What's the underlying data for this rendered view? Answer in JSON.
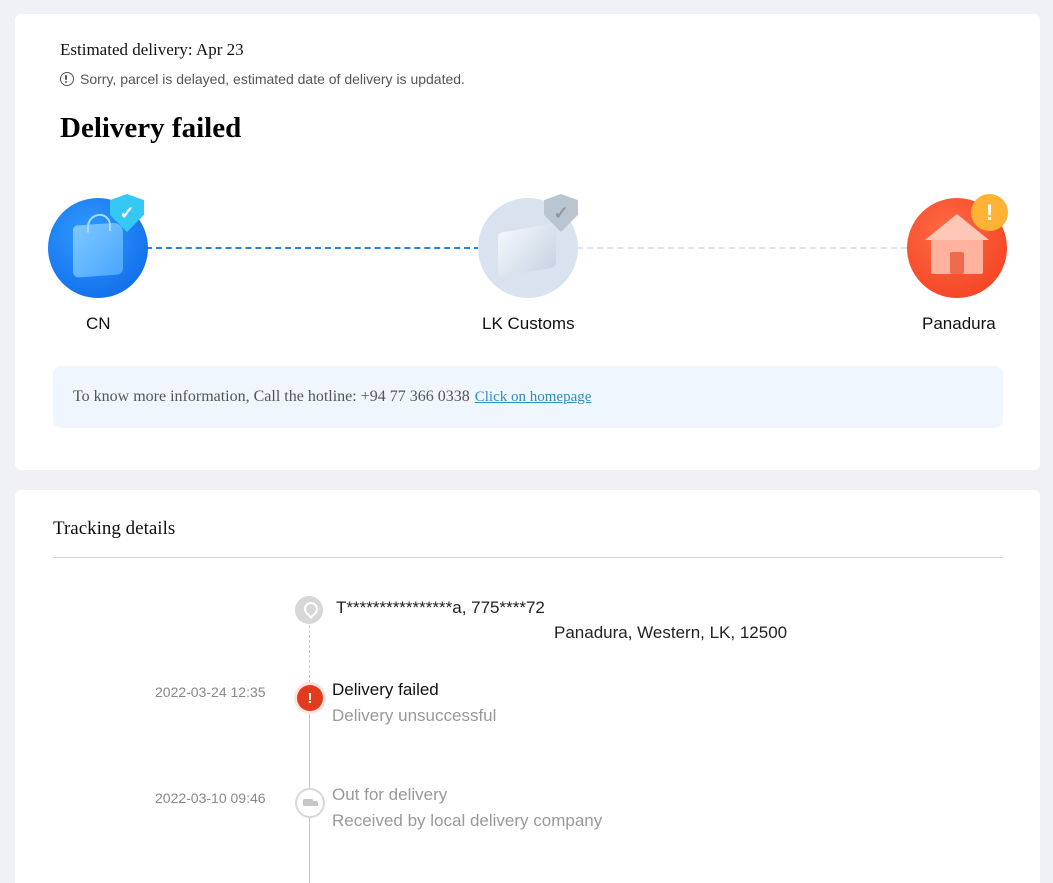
{
  "summary": {
    "estimated_delivery": "Estimated delivery: Apr 23",
    "delay_notice": "Sorry, parcel is delayed, estimated date of delivery is updated.",
    "status_title": "Delivery failed"
  },
  "route": {
    "nodes": [
      {
        "label": "CN",
        "icon": "shopping-bag-icon",
        "badge": "shield-check-icon",
        "color": "#0b63e6"
      },
      {
        "label": "LK Customs",
        "icon": "parcel-box-icon",
        "badge": "shield-check-icon",
        "color": "#d9e3ef"
      },
      {
        "label": "Panadura",
        "icon": "house-icon",
        "badge": "alert-icon",
        "color": "#f23c1d"
      }
    ]
  },
  "hotline": {
    "text": "To know more information, Call the hotline: +94 77 366 0338",
    "link": "Click on homepage"
  },
  "tracking": {
    "title": "Tracking details",
    "address_line1": "T****************a,  775****72",
    "address_line2": "Panadura,  Western,  LK,  12500",
    "events": [
      {
        "time": "2022-03-24 12:35",
        "title": "Delivery failed",
        "subtitle": "Delivery unsuccessful",
        "icon": "alert-icon"
      },
      {
        "time": "2022-03-10 09:46",
        "title": "Out for delivery",
        "subtitle": "Received by local delivery company",
        "icon": "truck-icon"
      }
    ]
  }
}
